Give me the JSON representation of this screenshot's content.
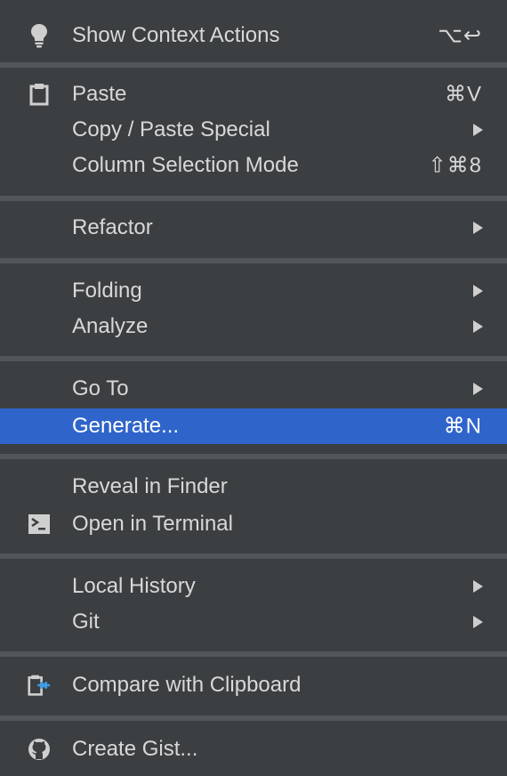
{
  "menu": {
    "show_context_actions": {
      "label": "Show Context Actions",
      "shortcut": "⌥↩"
    },
    "paste": {
      "label": "Paste",
      "shortcut": "⌘V"
    },
    "copy_paste_special": {
      "label": "Copy / Paste Special"
    },
    "column_selection_mode": {
      "label": "Column Selection Mode",
      "shortcut": "⇧⌘8"
    },
    "refactor": {
      "label": "Refactor"
    },
    "folding": {
      "label": "Folding"
    },
    "analyze": {
      "label": "Analyze"
    },
    "go_to": {
      "label": "Go To"
    },
    "generate": {
      "label": "Generate...",
      "shortcut": "⌘N"
    },
    "reveal_in_finder": {
      "label": "Reveal in Finder"
    },
    "open_in_terminal": {
      "label": "Open in Terminal"
    },
    "local_history": {
      "label": "Local History"
    },
    "git": {
      "label": "Git"
    },
    "compare_with_clipboard": {
      "label": "Compare with Clipboard"
    },
    "create_gist": {
      "label": "Create Gist..."
    }
  },
  "colors": {
    "background": "#3c3f41",
    "separator": "#515658",
    "selection": "#2f65ca",
    "text": "#d8d8d8",
    "compare_icon_accent": "#3f9de6"
  },
  "icons": {
    "show_context_actions": "lightbulb-icon",
    "paste": "clipboard-icon",
    "open_in_terminal": "terminal-icon",
    "compare_with_clipboard": "compare-clipboard-icon",
    "create_gist": "github-icon"
  }
}
